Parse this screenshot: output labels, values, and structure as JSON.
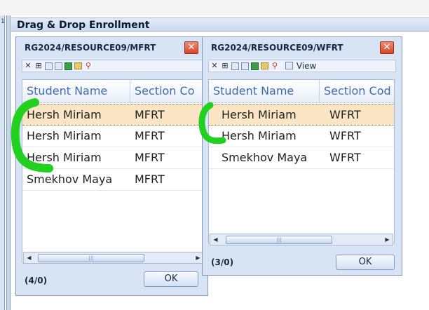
{
  "window": {
    "title": "Drag & Drop Enrollment",
    "side_marker": "1"
  },
  "left_dialog": {
    "title": "RG2024/RESOURCE09/MFRT",
    "columns": [
      "Student Name",
      "Section Co"
    ],
    "rows": [
      {
        "name": "Hersh  Miriam",
        "section": "MFRT",
        "selected": true
      },
      {
        "name": "Hersh  Miriam",
        "section": "MFRT",
        "selected": false
      },
      {
        "name": "Hersh  Miriam",
        "section": "MFRT",
        "selected": false
      },
      {
        "name": "Smekhov  Maya",
        "section": "MFRT",
        "selected": false
      }
    ],
    "count": "(4/0)",
    "ok_label": "OK"
  },
  "right_dialog": {
    "title": "RG2024/RESOURCE09/WFRT",
    "columns": [
      "Student Name",
      "Section Cod"
    ],
    "view_label": "View",
    "rows": [
      {
        "name": "Hersh  Miriam",
        "section": "WFRT",
        "selected": true
      },
      {
        "name": "Hersh  Miriam",
        "section": "WFRT",
        "selected": false
      },
      {
        "name": "Smekhov  Maya",
        "section": "WFRT",
        "selected": false
      }
    ],
    "count": "(3/0)",
    "ok_label": "OK"
  },
  "icons": {
    "close": "close-icon",
    "toolbar": [
      "delete-icon",
      "grid-icon",
      "export-icon",
      "page-icon",
      "excel-icon",
      "print-icon",
      "search-icon",
      "view-icon"
    ]
  },
  "colors": {
    "dialog_bg": "#d8e4f4",
    "header_text": "#3e6cb0",
    "selected_row": "#fce5c4",
    "close_button": "#d6452a",
    "annotation": "#22d11f"
  }
}
